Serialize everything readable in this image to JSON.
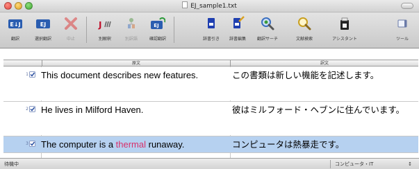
{
  "window": {
    "title": "EJ_sample1.txt"
  },
  "toolbar": {
    "buttons": [
      {
        "label": "翻訳",
        "icon": "translate-ej-icon",
        "enabled": true
      },
      {
        "label": "選択翻訳",
        "icon": "translate-selection-icon",
        "enabled": true
      },
      {
        "label": "中止",
        "icon": "stop-icon",
        "enabled": false
      },
      {
        "label": "別解釈",
        "icon": "alternative-interpretation-icon",
        "enabled": true
      },
      {
        "label": "別訳語",
        "icon": "alternative-word-icon",
        "enabled": false
      },
      {
        "label": "確認翻訳",
        "icon": "confirm-translation-icon",
        "enabled": true
      },
      {
        "label": "辞書引き",
        "icon": "dictionary-lookup-icon",
        "enabled": true
      },
      {
        "label": "辞書編集",
        "icon": "dictionary-edit-icon",
        "enabled": true
      },
      {
        "label": "翻訳サーチ",
        "icon": "translation-search-icon",
        "enabled": true
      },
      {
        "label": "文献検索",
        "icon": "document-search-icon",
        "enabled": true
      },
      {
        "label": "アシスタント",
        "icon": "assistant-icon",
        "enabled": true
      },
      {
        "label": "ツール",
        "icon": "tools-icon",
        "enabled": true
      }
    ]
  },
  "table": {
    "headers": {
      "source": "原文",
      "target": "訳文"
    },
    "rows": [
      {
        "num": "1",
        "checked": true,
        "source": "This document describes new features.",
        "target": "この書類は新しい機能を記述します。",
        "selected": false
      },
      {
        "num": "2",
        "checked": true,
        "source": "He lives in Milford Haven.",
        "target": "彼はミルフォード・ヘブンに住んでいます。",
        "selected": false
      },
      {
        "num": "3",
        "checked": true,
        "source_before": "The computer is a ",
        "source_highlight": "thermal",
        "source_after": " runaway.",
        "target": "コンピュータは熱暴走です。",
        "selected": true
      }
    ]
  },
  "status": {
    "text": "待機中",
    "field": "コンピュータ・IT",
    "field_arrows": "↕"
  },
  "colors": {
    "selection": "#b6d1f0",
    "highlight": "#d8306a",
    "ej_blue": "#1f4fa5"
  }
}
